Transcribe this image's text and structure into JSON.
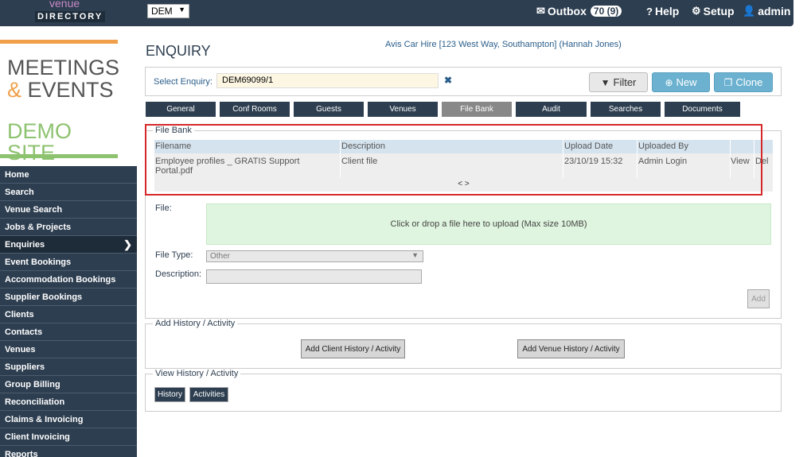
{
  "header": {
    "logo_line1": "venue",
    "logo_line2": "DIRECTORY",
    "company_select": "DEM",
    "outbox_label": "Outbox",
    "outbox_count": "70 (9)",
    "help_label": "Help",
    "setup_label": "Setup",
    "user_label": "admin"
  },
  "site_logo": {
    "line1": "MEETINGS",
    "amp": "&",
    "line2": "EVENTS",
    "line3": "DEMO SITE"
  },
  "sidebar": {
    "items": [
      {
        "label": "Home"
      },
      {
        "label": "Search"
      },
      {
        "label": "Venue Search"
      },
      {
        "label": "Jobs & Projects"
      },
      {
        "label": "Enquiries",
        "active": true
      },
      {
        "label": "Event Bookings"
      },
      {
        "label": "Accommodation Bookings"
      },
      {
        "label": "Supplier Bookings"
      },
      {
        "label": "Clients"
      },
      {
        "label": "Contacts"
      },
      {
        "label": "Venues"
      },
      {
        "label": "Suppliers"
      },
      {
        "label": "Group Billing"
      },
      {
        "label": "Reconciliation"
      },
      {
        "label": "Claims & Invoicing"
      },
      {
        "label": "Client Invoicing"
      },
      {
        "label": "Reports"
      }
    ]
  },
  "main": {
    "title": "ENQUIRY",
    "context": "Avis Car Hire [123 West Way, Southampton] (Hannah Jones)",
    "select_label": "Select Enquiry:",
    "select_value": "DEM69099/1",
    "filter_label": "Filter",
    "new_label": "New",
    "clone_label": "Clone",
    "tabs": [
      {
        "label": "General"
      },
      {
        "label": "Conf Rooms"
      },
      {
        "label": "Guests"
      },
      {
        "label": "Venues"
      },
      {
        "label": "File Bank",
        "active": true
      },
      {
        "label": "Audit"
      },
      {
        "label": "Searches"
      },
      {
        "label": "Documents"
      }
    ]
  },
  "file_bank": {
    "legend": "File Bank",
    "columns": [
      "Filename",
      "Description",
      "Upload Date",
      "Uploaded By"
    ],
    "rows": [
      {
        "filename_l1": "Employee profiles _ GRATIS Support",
        "filename_l2": "Portal.pdf",
        "description": "Client file",
        "upload_date": "23/10/19 15:32",
        "uploaded_by": "Admin Login",
        "view": "View",
        "delete": "Del"
      }
    ],
    "pager": "< >",
    "file_label": "File:",
    "dropzone_text": "Click or drop a file here to upload (Max size 10MB)",
    "file_type_label": "File Type:",
    "file_type_value": "Other",
    "description_label": "Description:",
    "add_label": "Add"
  },
  "add_history": {
    "legend": "Add History / Activity",
    "client_button": "Add Client History / Activity",
    "venue_button": "Add Venue History / Activity"
  },
  "view_history": {
    "legend": "View History / Activity",
    "history_button": "History",
    "activities_button": "Activities"
  },
  "colors": {
    "navy": "#2d3e50",
    "accent_blue": "#6cb2d0",
    "orange": "#f0a04b",
    "green": "#8dc26f",
    "highlight_red": "#d62728"
  }
}
